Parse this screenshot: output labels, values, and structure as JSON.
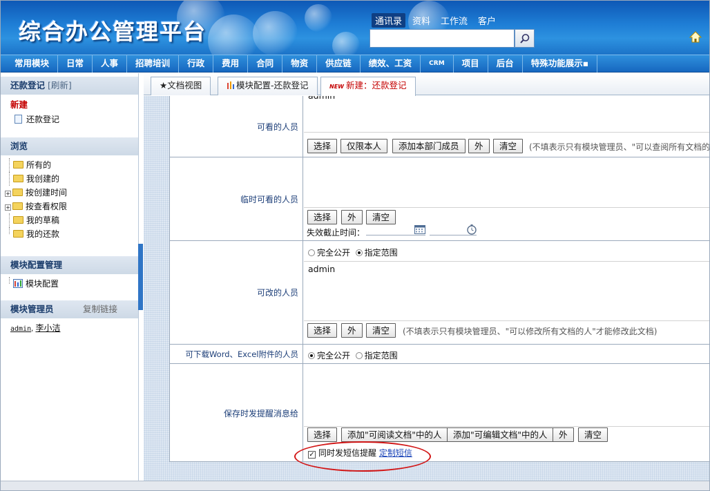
{
  "header": {
    "logo": "综合办公管理平台",
    "top_nav": [
      "通讯录",
      "资料",
      "工作流",
      "客户"
    ],
    "search_placeholder": ""
  },
  "menu": [
    "常用模块",
    "日常",
    "人事",
    "招聘培训",
    "行政",
    "费用",
    "合同",
    "物资",
    "供应链",
    "绩效、工资",
    "CRM",
    "项目",
    "后台",
    "特殊功能展示▪"
  ],
  "sidebar": {
    "title": "还款登记",
    "refresh": "[刷新]",
    "new_header": "新建",
    "new_item": "还款登记",
    "browse_header": "浏览",
    "browse_items": [
      "所有的",
      "我创建的",
      "按创建时间",
      "按查看权限",
      "我的草稿",
      "我的还款"
    ],
    "module_config_header": "模块配置管理",
    "module_config_item": "模块配置",
    "admins_header": "模块管理员",
    "copy_link": "复制链接",
    "admins": [
      "admin",
      "李小洁"
    ]
  },
  "tabs": [
    {
      "label": "★文档视图"
    },
    {
      "label": "模块配置-还款登记"
    },
    {
      "new_tag": "NEW",
      "label": "新建：还款登记"
    }
  ],
  "form": {
    "viewers": {
      "label": "可看的人员",
      "value": "admin",
      "buttons": [
        "选择",
        "仅限本人",
        "添加本部门成员",
        "外",
        "清空"
      ],
      "hint": "(不填表示只有模块管理员、\"可以查阅所有文档的人"
    },
    "temp_viewers": {
      "label": "临时可看的人员",
      "buttons": [
        "选择",
        "外",
        "清空"
      ],
      "expiry_label": "失效截止时间："
    },
    "editors": {
      "label": "可改的人员",
      "radio_options": [
        "完全公开",
        "指定范围"
      ],
      "selected": "指定范围",
      "value": "admin",
      "buttons": [
        "选择",
        "外",
        "清空"
      ],
      "hint": "(不填表示只有模块管理员、\"可以修改所有文档的人\"才能修改此文档)"
    },
    "downloaders": {
      "label": "可下载Word、Excel附件的人员",
      "radio_options": [
        "完全公开",
        "指定范围"
      ],
      "selected": "完全公开"
    },
    "notify": {
      "label": "保存时发提醒消息给",
      "buttons": [
        "选择",
        "添加\"可阅读文档\"中的人",
        "添加\"可编辑文档\"中的人",
        "外",
        "清空"
      ],
      "sms_checkbox": "同时发短信提醒",
      "sms_checked": true,
      "sms_link": "定制短信"
    }
  },
  "colors": {
    "header_blue": "#1f7fd6",
    "menu_blue": "#1667bf",
    "label_blue": "#1c3e78",
    "highlight_red": "#d21616"
  }
}
